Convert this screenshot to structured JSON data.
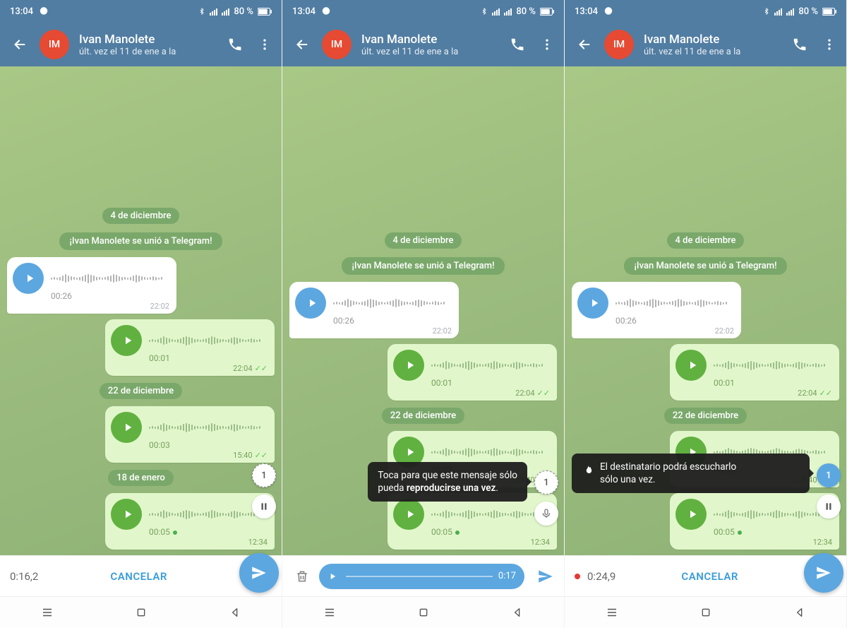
{
  "status": {
    "time": "13:04",
    "battery": "80 %"
  },
  "header": {
    "avatar_initials": "IM",
    "name": "Ivan Manolete",
    "last_seen": "últ. vez el 11 de ene a la"
  },
  "dates": {
    "d1": "4 de diciembre",
    "d2": "22 de diciembre",
    "d3": "18 de enero"
  },
  "service": {
    "joined": "¡Ivan Manolete se unió a Telegram!"
  },
  "messages": {
    "m1": {
      "duration": "00:26",
      "time": "22:02"
    },
    "m2": {
      "duration": "00:01",
      "time": "22:04"
    },
    "m3": {
      "duration": "00:03",
      "time": "15:40"
    },
    "m4": {
      "duration": "00:05",
      "time": "12:34"
    }
  },
  "once_button": {
    "label": "1"
  },
  "tooltips": {
    "tap_once_line1": "Toca para que este mensaje sólo",
    "tap_once_line2a": "pueda ",
    "tap_once_line2b": "reproducirse una vez",
    "recipient_once_line1": "El destinatario podrá escucharlo",
    "recipient_once_line2": "sólo una vez."
  },
  "input": {
    "s1_timer": "0:16,2",
    "s1_cancel": "CANCELAR",
    "s2_preview_dur": "0:17",
    "s3_timer": "0:24,9",
    "s3_cancel": "CANCELAR"
  },
  "colors": {
    "telegram_header": "#517da2",
    "bubble_out": "#e1f7cb",
    "play_blue": "#5ca7e0",
    "play_green": "#61b140",
    "avatar": "#e64a33"
  }
}
